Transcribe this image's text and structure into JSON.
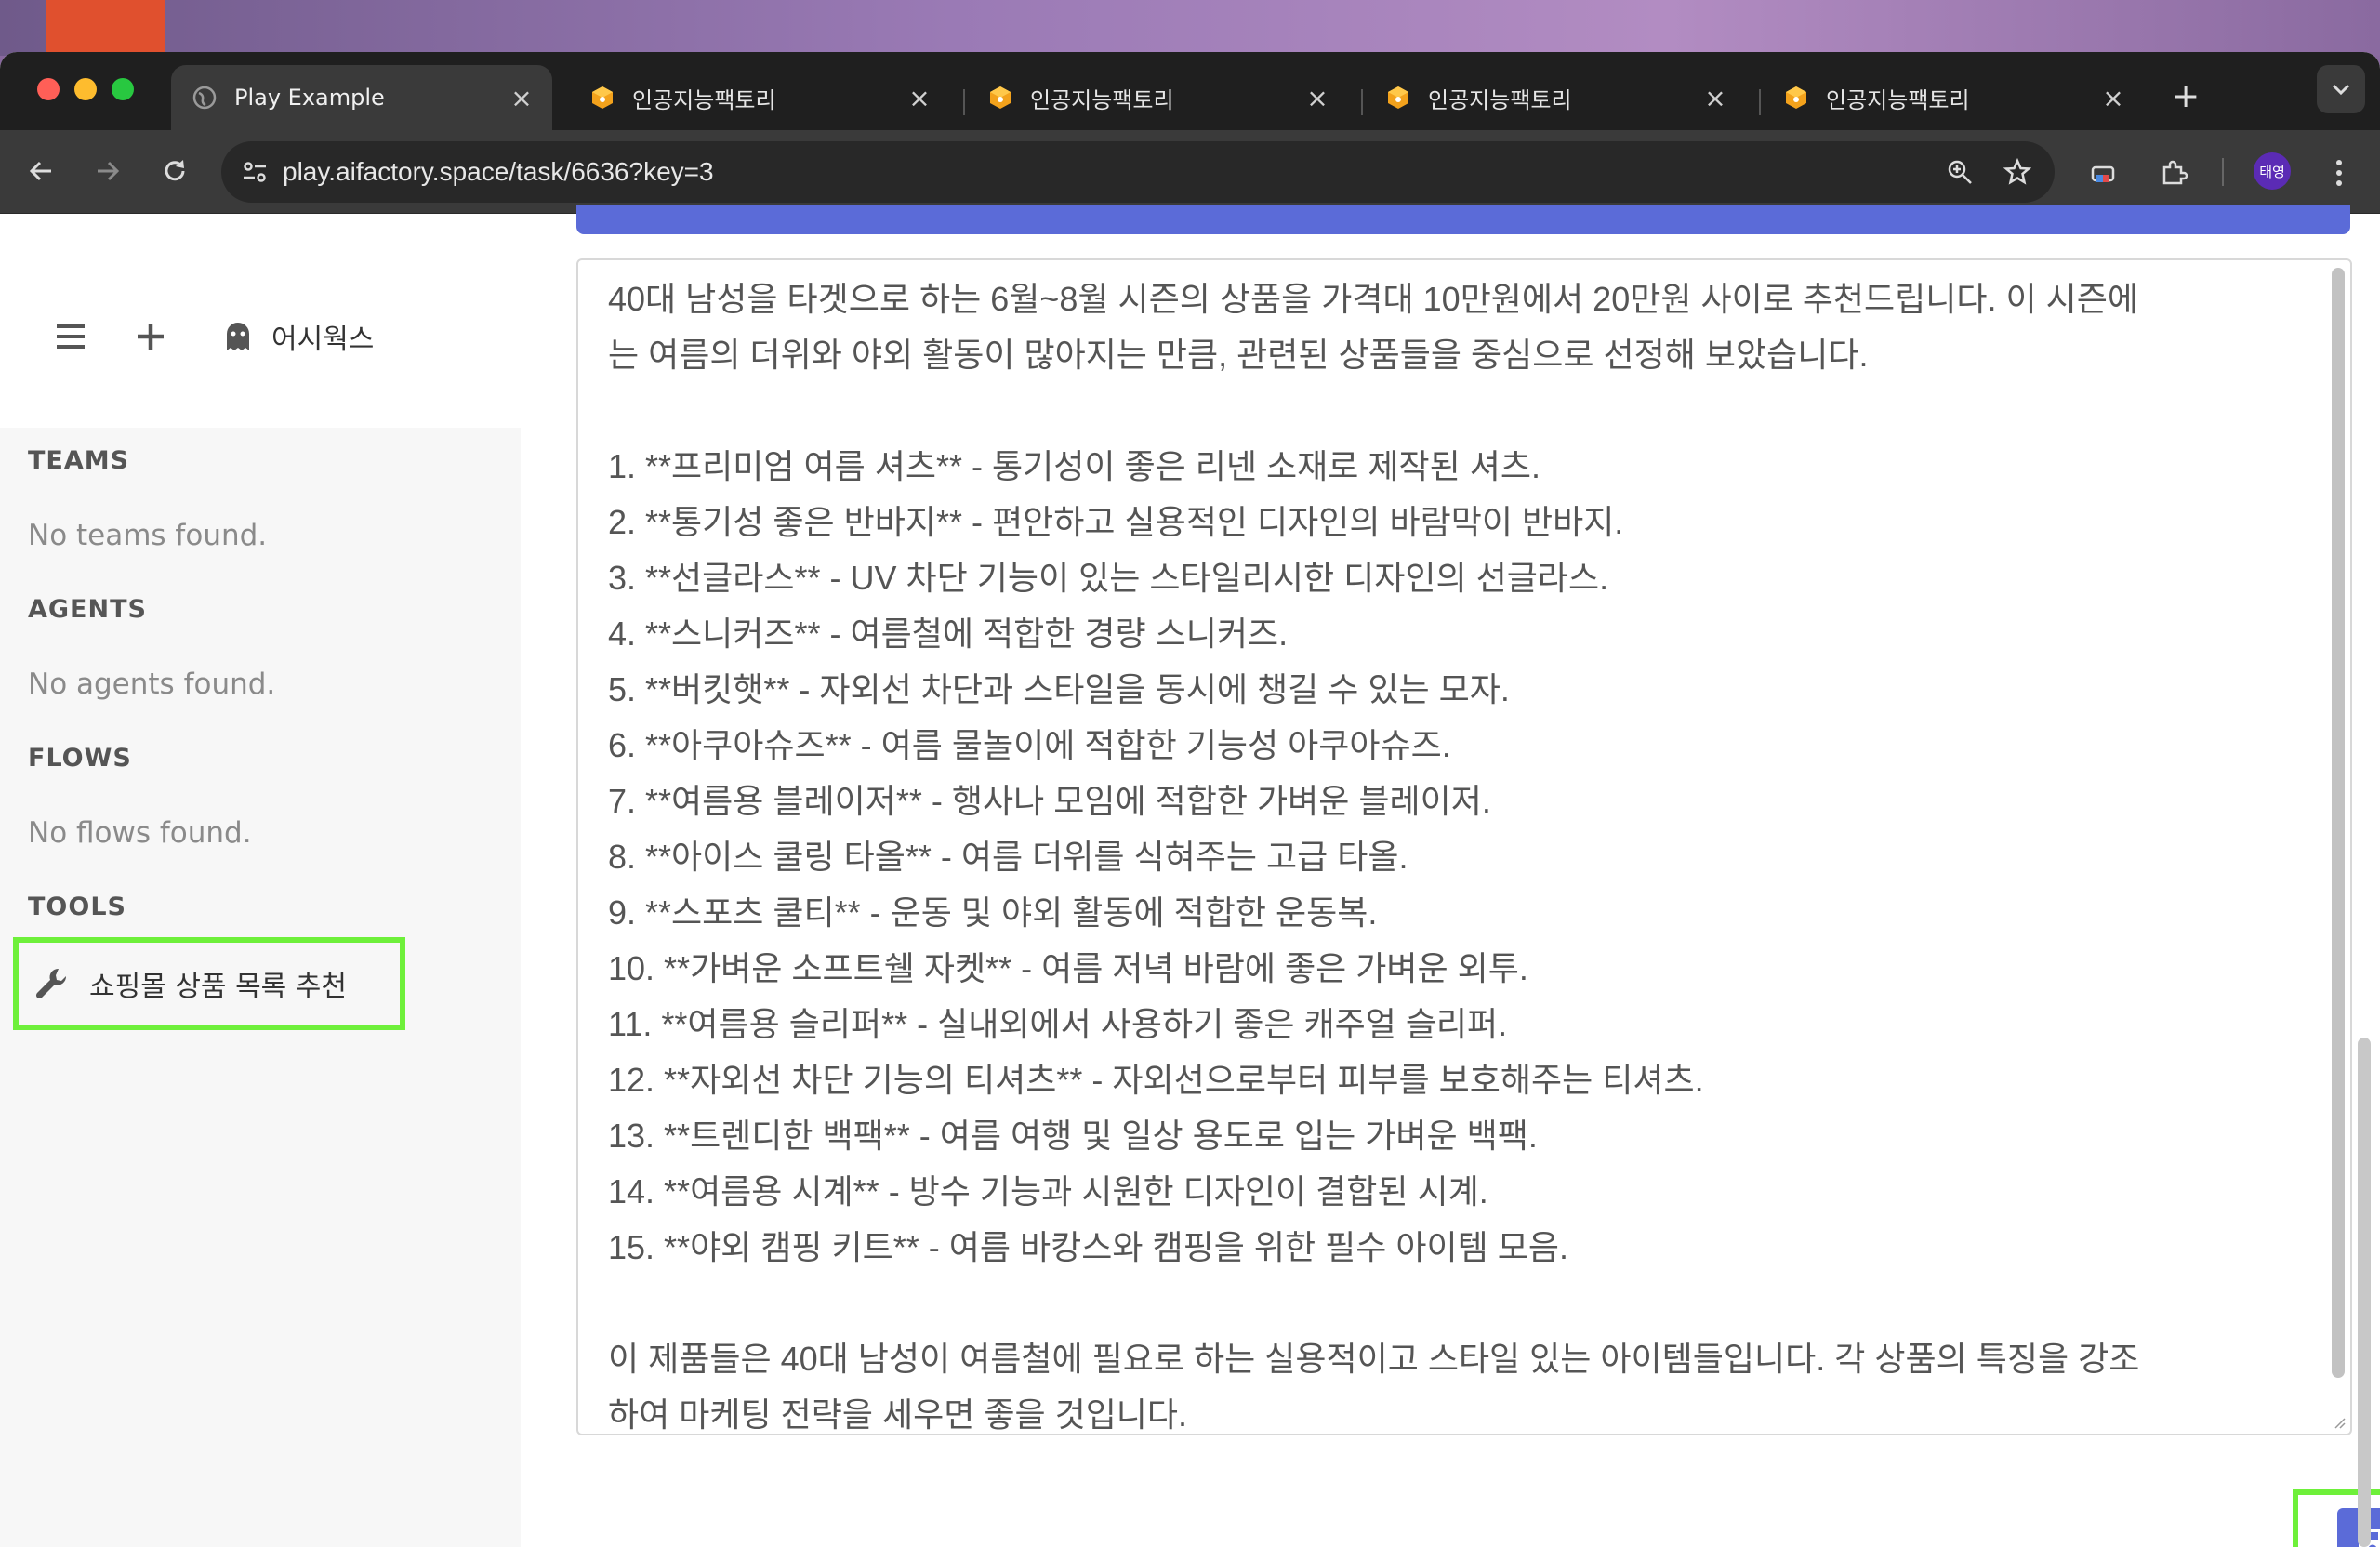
{
  "browser": {
    "tabs": [
      {
        "title": "Play Example",
        "active": true,
        "icon": "globe-icon"
      },
      {
        "title": "인공지능팩토리",
        "active": false,
        "icon": "aifactory-cube-icon"
      },
      {
        "title": "인공지능팩토리",
        "active": false,
        "icon": "aifactory-cube-icon"
      },
      {
        "title": "인공지능팩토리",
        "active": false,
        "icon": "aifactory-cube-icon"
      },
      {
        "title": "인공지능팩토리",
        "active": false,
        "icon": "aifactory-cube-icon"
      }
    ],
    "tab_close": "×",
    "new_tab": "+",
    "url": "play.aifactory.space/task/6636?key=3",
    "profile_initials": "태영"
  },
  "sidebar": {
    "workspace_name": "어시웍스",
    "sections": {
      "teams": {
        "title": "TEAMS",
        "empty": "No teams found."
      },
      "agents": {
        "title": "AGENTS",
        "empty": "No agents found."
      },
      "flows": {
        "title": "FLOWS",
        "empty": "No flows found."
      },
      "tools": {
        "title": "TOOLS",
        "items": [
          {
            "label": "쇼핑몰 상품 목록 추천",
            "icon": "wrench-icon"
          }
        ]
      }
    }
  },
  "main": {
    "output_lines": [
      "40대 남성을 타겟으로 하는 6월~8월 시즌의 상품을 가격대 10만원에서 20만원 사이로 추천드립니다. 이 시즌에",
      "는 여름의 더위와 야외 활동이 많아지는 만큼, 관련된 상품들을 중심으로 선정해 보았습니다.",
      "",
      "1. **프리미엄 여름 셔츠** - 통기성이 좋은 리넨 소재로 제작된 셔츠.",
      "2. **통기성 좋은 반바지** - 편안하고 실용적인 디자인의 바람막이 반바지.",
      "3. **선글라스** - UV 차단 기능이 있는 스타일리시한 디자인의 선글라스.",
      "4. **스니커즈** - 여름철에 적합한 경량 스니커즈.",
      "5. **버킷햇** - 자외선 차단과 스타일을 동시에 챙길 수 있는 모자.",
      "6. **아쿠아슈즈** - 여름 물놀이에 적합한 기능성 아쿠아슈즈.",
      "7. **여름용 블레이저** - 행사나 모임에 적합한 가벼운 블레이저.",
      "8. **아이스 쿨링 타올** - 여름 더위를 식혀주는 고급 타올.",
      "9. **스포츠 쿨티** - 운동 및 야외 활동에 적합한 운동복.",
      "10. **가벼운 소프트쉘 자켓** - 여름 저녁 바람에 좋은 가벼운 외투.",
      "11. **여름용 슬리퍼** - 실내외에서 사용하기 좋은 캐주얼 슬리퍼.",
      "12. **자외선 차단 기능의 티셔츠** - 자외선으로부터 피부를 보호해주는 티셔츠.",
      "13. **트렌디한 백팩** - 여름 여행 및 일상 용도로 입는 가벼운 백팩.",
      "14. **여름용 시계** - 방수 기능과 시원한 디자인이 결합된 시계.",
      "15. **야외 캠핑 키트** - 여름 바캉스와 캠핑을 위한 필수 아이템 모음.",
      "",
      "이 제품들은 40대 남성이 여름철에 필요로 하는 실용적이고 스타일 있는 아이템들입니다. 각 상품의 특징을 강조",
      "하여 마케팅 전략을 세우면 좋을 것입니다."
    ],
    "save_icon": "save-floppy-icon"
  },
  "colors": {
    "accent": "#5b6bd8",
    "highlight": "#6ef03a",
    "chrome_dark": "#1f1f1f",
    "chrome_toolbar": "#3a3a3a",
    "sidebar_bg": "#f7f7f7"
  }
}
